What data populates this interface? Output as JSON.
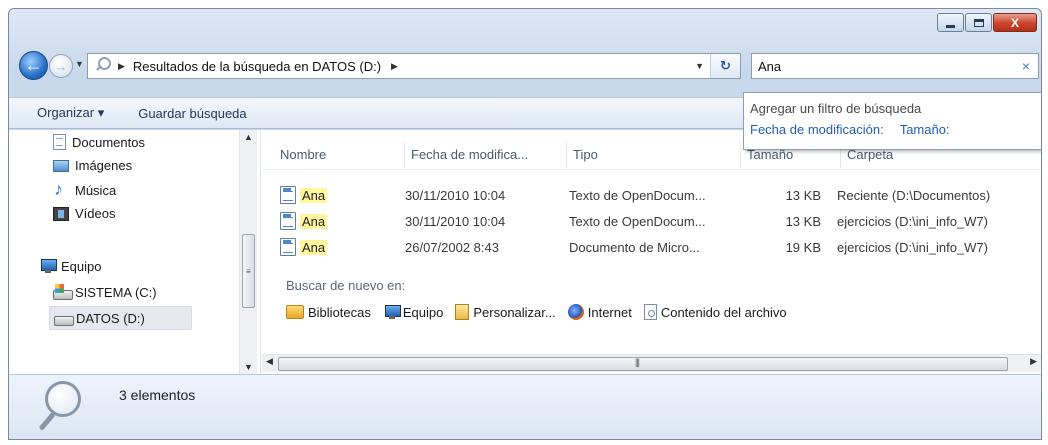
{
  "window": {
    "close_glyph": "X"
  },
  "navigation": {
    "breadcrumb": "Resultados de la búsqueda en DATOS (D:)"
  },
  "search": {
    "value": "Ana",
    "clear_glyph": "×"
  },
  "toolbar": {
    "organize_label": "Organizar ▾",
    "save_search_label": "Guardar búsqueda"
  },
  "search_dropdown": {
    "title": "Agregar un filtro de búsqueda",
    "filter_date": "Fecha de modificación:",
    "filter_size": "Tamaño:"
  },
  "sidebar": {
    "items": [
      {
        "label": "Documentos",
        "icon": "document-icon"
      },
      {
        "label": "Imágenes",
        "icon": "image-icon"
      },
      {
        "label": "Música",
        "icon": "music-icon"
      },
      {
        "label": "Vídeos",
        "icon": "video-icon"
      }
    ],
    "computer": {
      "label": "Equipo",
      "icon": "computer-icon"
    },
    "drives": [
      {
        "label": "SISTEMA (C:)",
        "icon": "system-drive-icon"
      },
      {
        "label": "DATOS (D:)",
        "icon": "drive-icon",
        "selected": true
      }
    ]
  },
  "file_list": {
    "columns": [
      "Nombre",
      "Fecha de modifica...",
      "Tipo",
      "Tamaño",
      "Carpeta"
    ],
    "rows": [
      {
        "name": "Ana",
        "date": "30/11/2010 10:04",
        "type": "Texto de OpenDocum...",
        "size": "13 KB",
        "folder": "Reciente (D:\\Documentos)"
      },
      {
        "name": "Ana",
        "date": "30/11/2010 10:04",
        "type": "Texto de OpenDocum...",
        "size": "13 KB",
        "folder": "ejercicios (D:\\ini_info_W7)"
      },
      {
        "name": "Ana",
        "date": "26/07/2002 8:43",
        "type": "Documento de Micro...",
        "size": "19 KB",
        "folder": "ejercicios (D:\\ini_info_W7)"
      }
    ]
  },
  "search_again": {
    "label": "Buscar de nuevo en:",
    "locations": [
      {
        "label": "Bibliotecas",
        "icon": "library-icon"
      },
      {
        "label": "Equipo",
        "icon": "computer-icon"
      },
      {
        "label": "Personalizar...",
        "icon": "custom-folder-icon"
      },
      {
        "label": "Internet",
        "icon": "browser-icon"
      },
      {
        "label": "Contenido del archivo",
        "icon": "file-content-icon"
      }
    ]
  },
  "status": {
    "item_count": "3 elementos"
  }
}
